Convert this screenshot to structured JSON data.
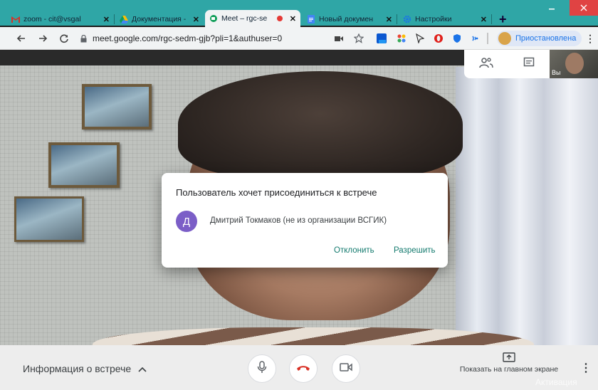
{
  "browser": {
    "tabs": [
      {
        "label": "zoom - cit@vsgal",
        "icon": "gmail-icon"
      },
      {
        "label": "Документация -",
        "icon": "google-drive-icon"
      },
      {
        "label": "Meet – rgc-se",
        "icon": "google-meet-icon"
      },
      {
        "label": "Новый докумен",
        "icon": "google-docs-icon"
      },
      {
        "label": "Настройки",
        "icon": "settings-gear-icon"
      }
    ],
    "close_glyph": "✕",
    "new_tab_glyph": "+",
    "url": "meet.google.com/rgc-sedm-gjb?pli=1&authuser=0",
    "profile_label": "Приостановлена",
    "accent": "#2fa6a6"
  },
  "meet": {
    "self_label": "Вы"
  },
  "dialog": {
    "title": "Пользователь хочет присоединиться к встрече",
    "avatar_letter": "Д",
    "user": "Дмитрий Токмаков (не из организации ВСГИК)",
    "deny_label": "Отклонить",
    "allow_label": "Разрешить"
  },
  "controls": {
    "meeting_info_label": "Информация о встрече",
    "present_label": "Показать на главном экране"
  },
  "watermark": "Активация"
}
